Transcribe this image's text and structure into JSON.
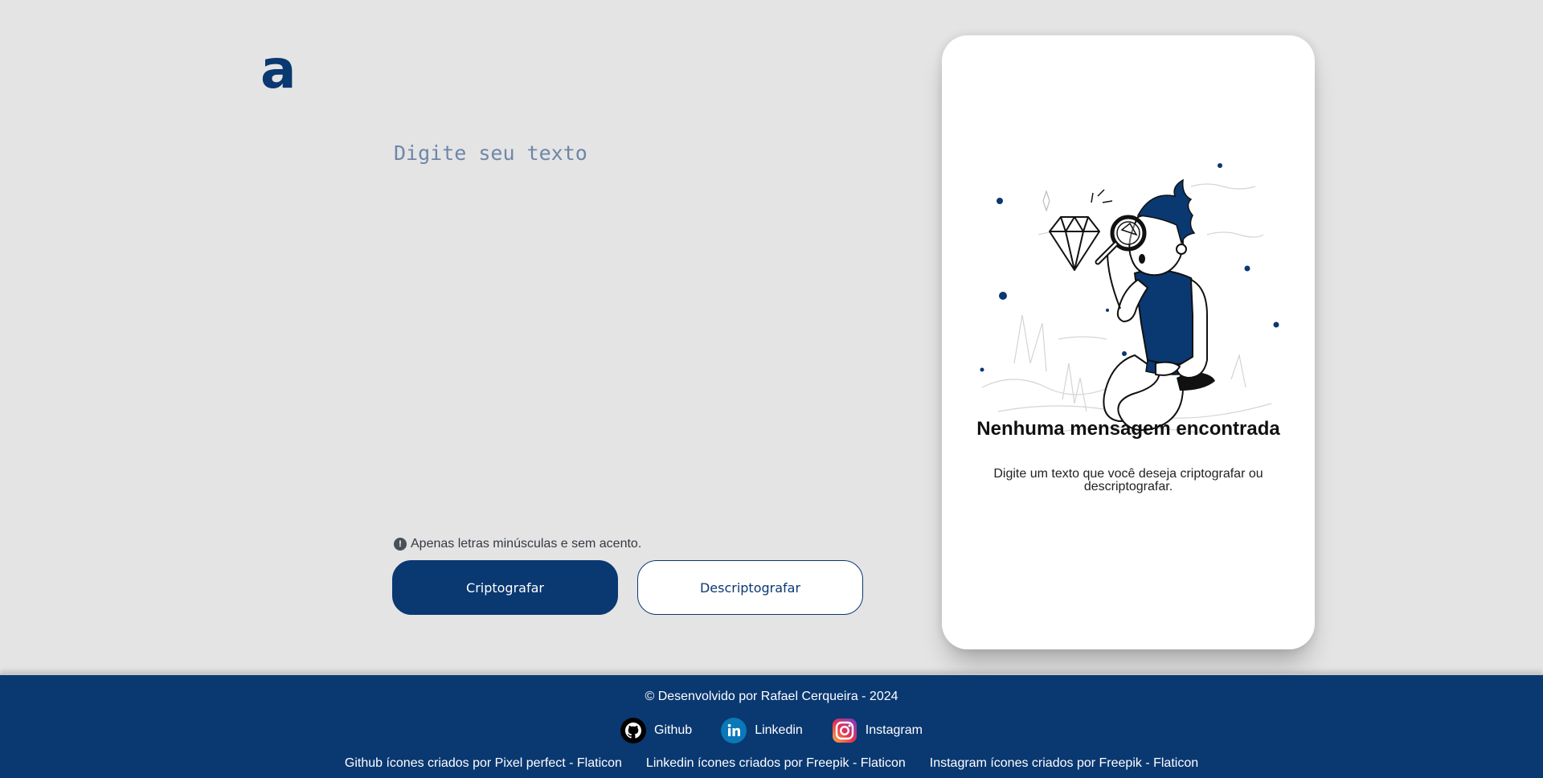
{
  "app": {
    "logo_text": "a"
  },
  "input": {
    "placeholder": "Digite seu texto",
    "hint_icon": "!",
    "hint": "Apenas letras minúsculas e sem acento."
  },
  "buttons": {
    "encrypt_label": "Criptografar",
    "decrypt_label": "Descriptografar"
  },
  "output": {
    "illustration_icon": "person-magnifying-glass-diamond-illustration",
    "title": "Nenhuma mensagem encontrada",
    "description": "Digite um texto que você deseja criptografar ou descriptografar."
  },
  "footer": {
    "copyright": "© Desenvolvido por Rafael Cerqueira - 2024",
    "socials": [
      {
        "icon": "github-icon",
        "label": "Github"
      },
      {
        "icon": "linkedin-icon",
        "label": "Linkedin"
      },
      {
        "icon": "instagram-icon",
        "label": "Instagram"
      }
    ],
    "credits": [
      "Github ícones criados por Pixel perfect - Flaticon",
      "Linkedin ícones criados por Freepik - Flaticon",
      "Instagram ícones criados por Freepik - Flaticon"
    ]
  },
  "colors": {
    "primary": "#0a3871",
    "background": "#e4e4e5",
    "card": "#ffffff",
    "placeholder": "#6f86a6"
  }
}
